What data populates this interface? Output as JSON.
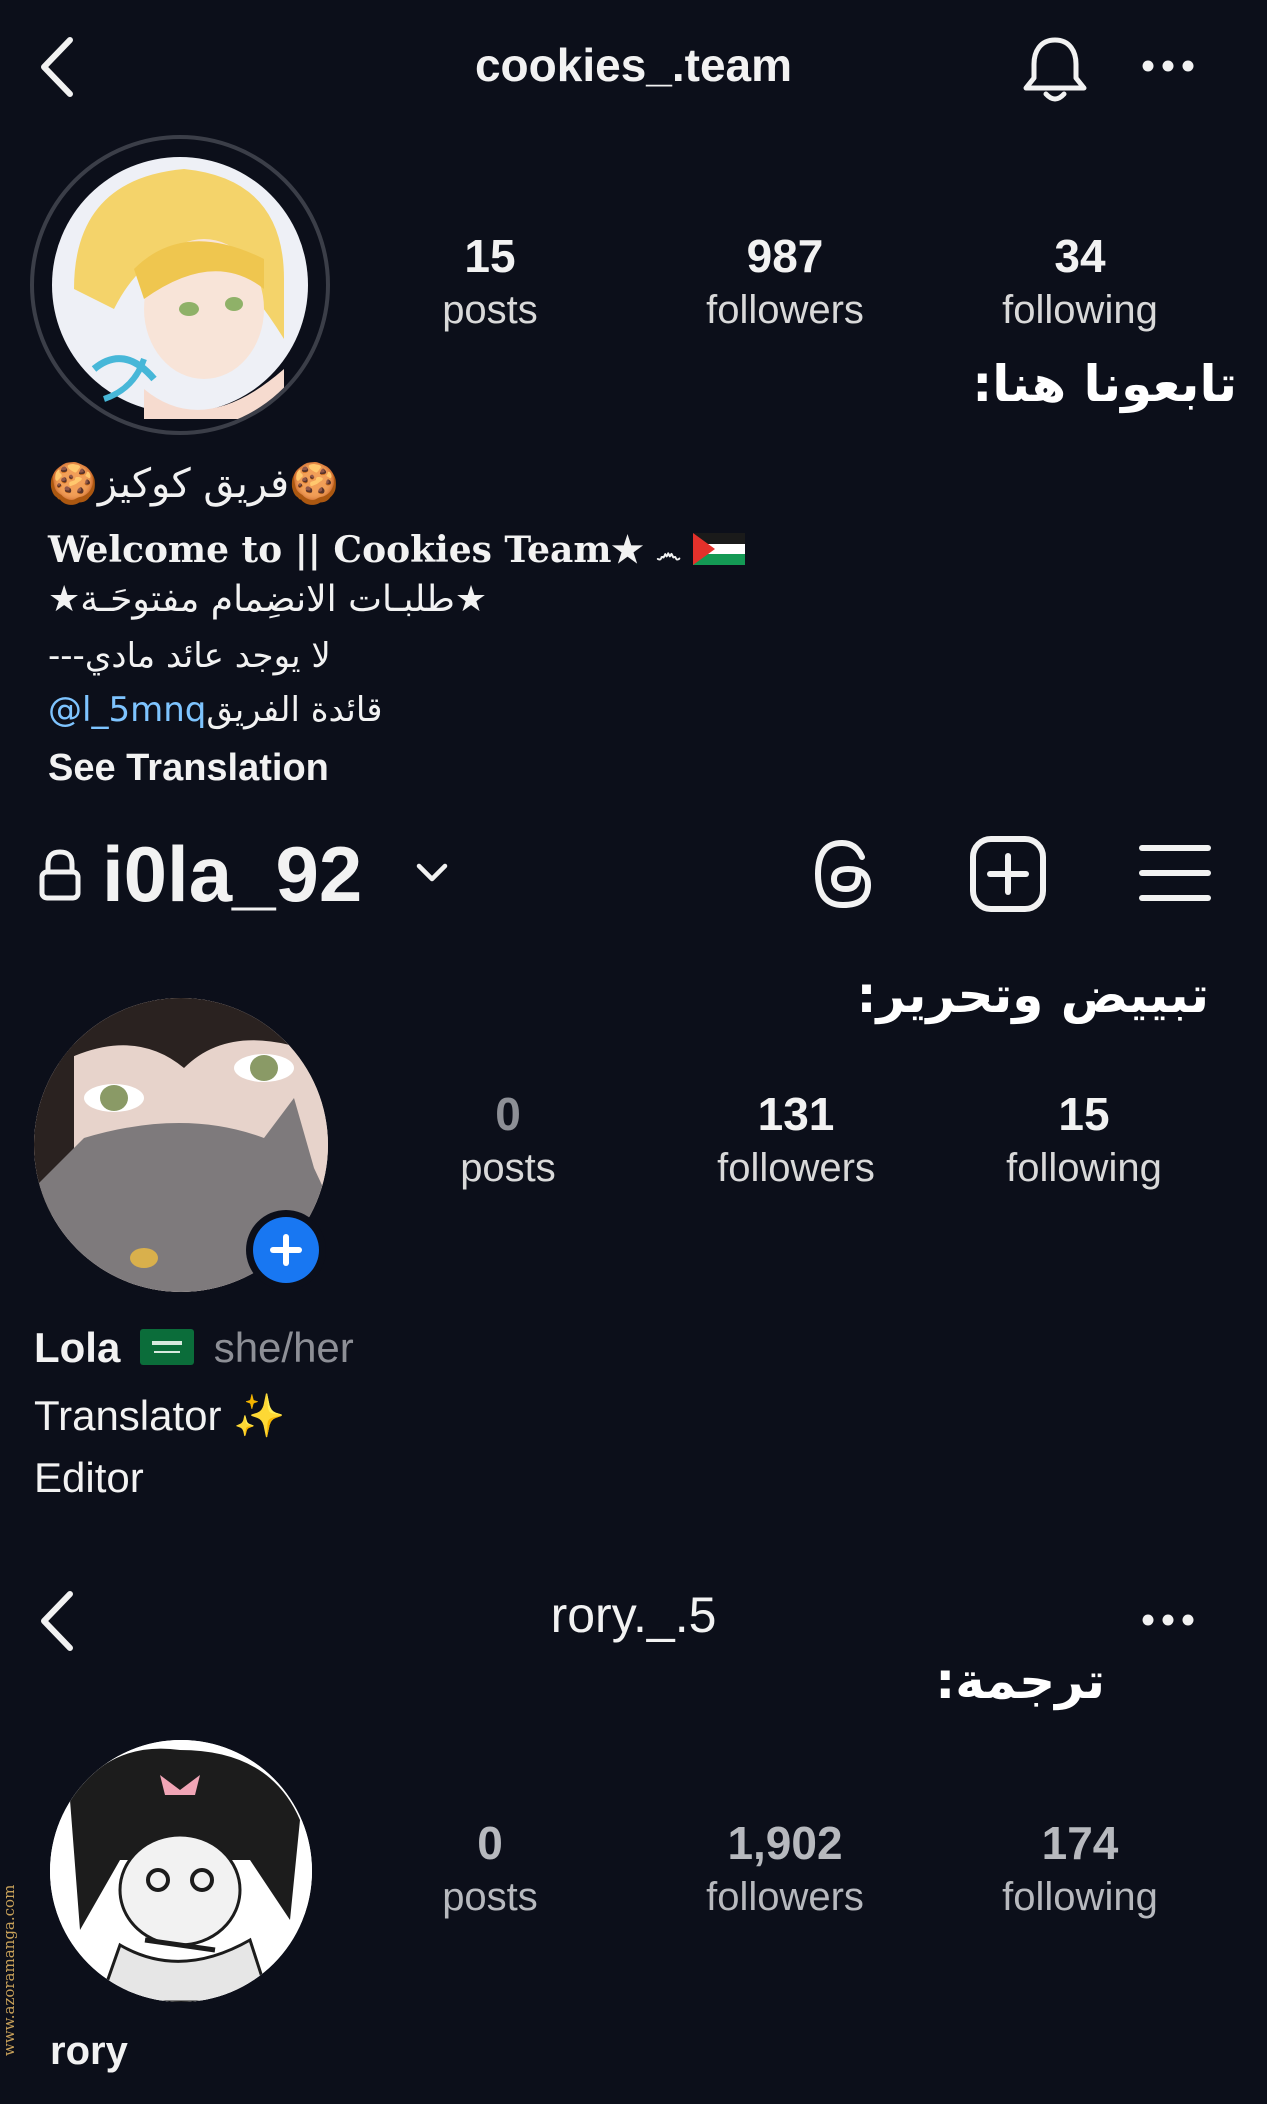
{
  "colors": {
    "background": "#0c0f1a",
    "link": "#7ec4ff",
    "accent_blue": "#1877f2",
    "watermark": "#c8a15a"
  },
  "profile1": {
    "username": "cookies_.team",
    "stats": {
      "posts_num": "15",
      "posts_label": "posts",
      "followers_num": "987",
      "followers_label": "followers",
      "following_num": "34",
      "following_label": "following"
    },
    "note": "تابعونا هنا:",
    "bio": {
      "name": "🍪فريق كوكيز🍪",
      "line1": "Welcome to || Cookies Team★",
      "line2": "★طلبـات الانضِمام مفتوحَـة★",
      "line3": "---لا يوجد عائد مادي",
      "line4_text": "قائدة الفريق ",
      "line4_link": "@l_5mnq",
      "see_translation": "See Translation"
    }
  },
  "profile2": {
    "username": "i0la_92",
    "note": "تبييض وتحرير:",
    "stats": {
      "posts_num": "0",
      "posts_label": "posts",
      "followers_num": "131",
      "followers_label": "followers",
      "following_num": "15",
      "following_label": "following"
    },
    "name": "Lola",
    "flag": "🇸🇦",
    "pronouns": "she/her",
    "bio_line1": "Translator ✨",
    "bio_line2": "Editor"
  },
  "profile3": {
    "username": "rory._.5",
    "note": "ترجمة:",
    "stats": {
      "posts_num": "0",
      "posts_label": "posts",
      "followers_num": "1,902",
      "followers_label": "followers",
      "following_num": "174",
      "following_label": "following"
    },
    "name": "rory"
  },
  "watermark": "www.azoramanga.com"
}
